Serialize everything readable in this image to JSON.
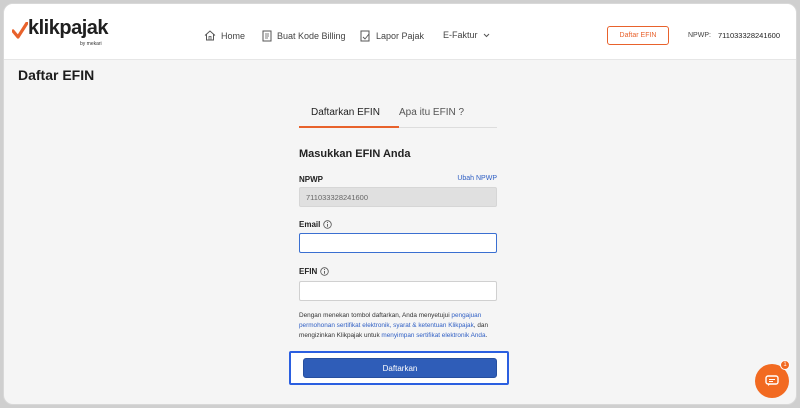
{
  "brand": {
    "name": "klikpajak",
    "tagline": "by mekari",
    "accent": "#e8622c"
  },
  "nav": {
    "items": [
      {
        "label": "Home",
        "icon": "home-icon"
      },
      {
        "label": "Buat Kode Billing",
        "icon": "document-icon"
      },
      {
        "label": "Lapor Pajak",
        "icon": "report-icon"
      },
      {
        "label": "E-Faktur",
        "icon": "chevron-down-icon"
      }
    ],
    "cta_label": "Daftar EFIN",
    "npwp_label": "NPWP:",
    "npwp_value": "711033328241600"
  },
  "page": {
    "title": "Daftar EFIN"
  },
  "tabs": [
    {
      "label": "Daftarkan EFIN",
      "active": true
    },
    {
      "label": "Apa itu EFIN ?",
      "active": false
    }
  ],
  "form": {
    "title": "Masukkan EFIN Anda",
    "npwp": {
      "label": "NPWP",
      "value": "711033328241600",
      "change_link": "Ubah NPWP"
    },
    "email": {
      "label": "Email",
      "value": "",
      "placeholder": ""
    },
    "efin": {
      "label": "EFIN",
      "value": "",
      "placeholder": ""
    },
    "terms": {
      "prefix": "Dengan menekan tombol daftarkan, Anda menyetujui ",
      "link1": "pengajuan permohonan sertifikat elektronik, syarat & ketentuan Klikpajak",
      "middle": ", dan mengizinkan Klikpajak untuk ",
      "link2": "menyimpan sertifikat elektronik Anda",
      "suffix": "."
    },
    "submit_label": "Daftarkan"
  },
  "chat": {
    "badge_count": "1",
    "icon": "chat-icon"
  }
}
